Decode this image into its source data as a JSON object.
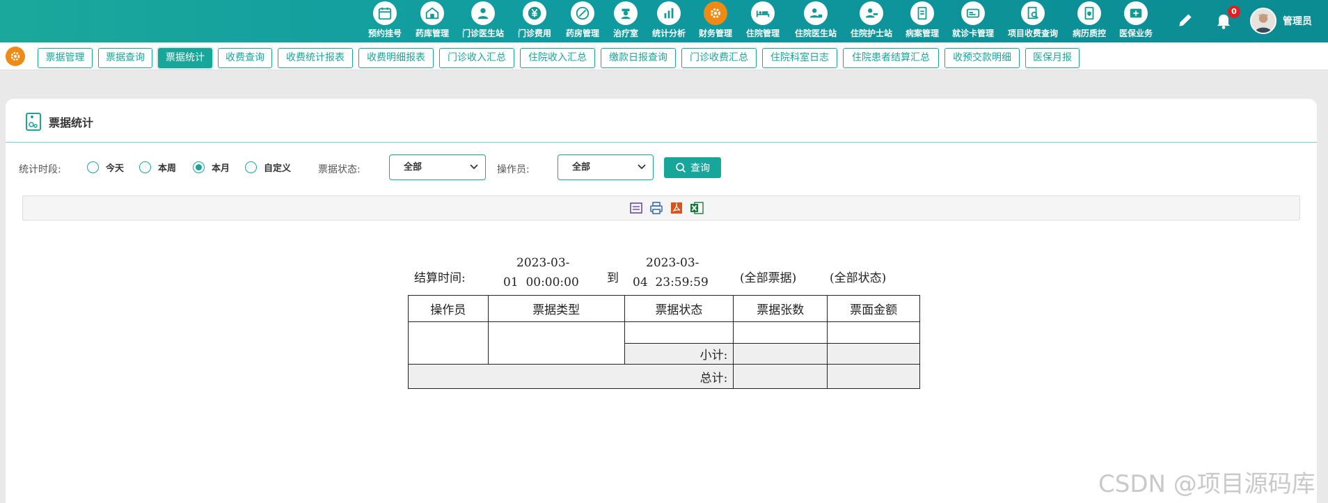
{
  "top_nav": {
    "items": [
      {
        "label": "预约挂号",
        "icon": "calendar-icon"
      },
      {
        "label": "药库管理",
        "icon": "warehouse-icon"
      },
      {
        "label": "门诊医生站",
        "icon": "doctor-icon"
      },
      {
        "label": "门诊费用",
        "icon": "yuan-icon"
      },
      {
        "label": "药房管理",
        "icon": "pill-icon"
      },
      {
        "label": "治疗室",
        "icon": "nurse-icon"
      },
      {
        "label": "统计分析",
        "icon": "bar-chart-icon"
      },
      {
        "label": "财务管理",
        "icon": "gear-icon",
        "active": true
      },
      {
        "label": "住院管理",
        "icon": "bed-icon"
      },
      {
        "label": "住院医生站",
        "icon": "doctor-card-icon"
      },
      {
        "label": "住院护士站",
        "icon": "nurse-card-icon"
      },
      {
        "label": "病案管理",
        "icon": "file-icon"
      },
      {
        "label": "就诊卡管理",
        "icon": "card-icon"
      },
      {
        "label": "项目收费查询",
        "icon": "search-doc-icon"
      },
      {
        "label": "病历质控",
        "icon": "shield-doc-icon"
      },
      {
        "label": "医保业务",
        "icon": "insurance-icon"
      }
    ],
    "notification_count": "0",
    "username": "管理员"
  },
  "sub_tabs": [
    {
      "label": "票据管理"
    },
    {
      "label": "票据查询"
    },
    {
      "label": "票据统计",
      "active": true
    },
    {
      "label": "收费查询"
    },
    {
      "label": "收费统计报表"
    },
    {
      "label": "收费明细报表"
    },
    {
      "label": "门诊收入汇总"
    },
    {
      "label": "住院收入汇总"
    },
    {
      "label": "缴款日报查询"
    },
    {
      "label": "门诊收费汇总"
    },
    {
      "label": "住院科室日志"
    },
    {
      "label": "住院患者结算汇总"
    },
    {
      "label": "收预交款明细"
    },
    {
      "label": "医保月报"
    }
  ],
  "page": {
    "title": "票据统计"
  },
  "filters": {
    "period_label": "统计时段:",
    "period_options": [
      {
        "label": "今天",
        "checked": false
      },
      {
        "label": "本周",
        "checked": false
      },
      {
        "label": "本月",
        "checked": true
      },
      {
        "label": "自定义",
        "checked": false
      }
    ],
    "status_label": "票据状态:",
    "status_value": "全部",
    "operator_label": "操作员:",
    "operator_value": "全部",
    "query_label": "查询"
  },
  "toolbar": {
    "icons": [
      "print-preview-icon",
      "print-icon",
      "pdf-icon",
      "excel-icon"
    ]
  },
  "report": {
    "settle_label": "结算时间:",
    "start_line1": "2023-03-",
    "start_line2": "01  00:00:00",
    "to_label": "到",
    "end_line1": "2023-03-",
    "end_line2": "04  23:59:59",
    "scope": "(全部票据)",
    "status": "(全部状态)",
    "columns": [
      "操作员",
      "票据类型",
      "票据状态",
      "票据张数",
      "票面金额"
    ],
    "subtotal_label": "小计:",
    "total_label": "总计:"
  },
  "watermark": "CSDN @项目源码库"
}
